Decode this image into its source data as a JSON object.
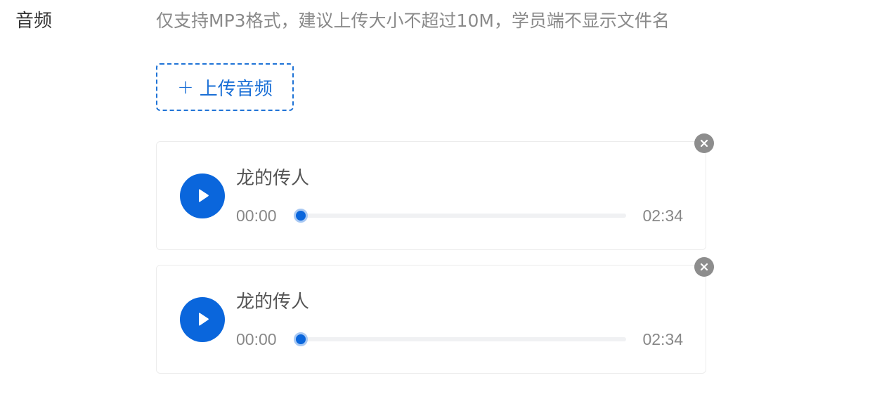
{
  "field": {
    "label": "音频",
    "hint": "仅支持MP3格式，建议上传大小不超过10M，学员端不显示文件名"
  },
  "upload": {
    "plus": "+",
    "label": "上传音频",
    "icon": "plus-icon"
  },
  "colors": {
    "accent": "#0a66dc",
    "remove": "#8d8d8d"
  },
  "audios": [
    {
      "title": "龙的传人",
      "current_time": "00:00",
      "duration": "02:34",
      "progress": 0,
      "play_icon": "play-icon",
      "remove_icon": "close-icon"
    },
    {
      "title": "龙的传人",
      "current_time": "00:00",
      "duration": "02:34",
      "progress": 0,
      "play_icon": "play-icon",
      "remove_icon": "close-icon"
    }
  ]
}
